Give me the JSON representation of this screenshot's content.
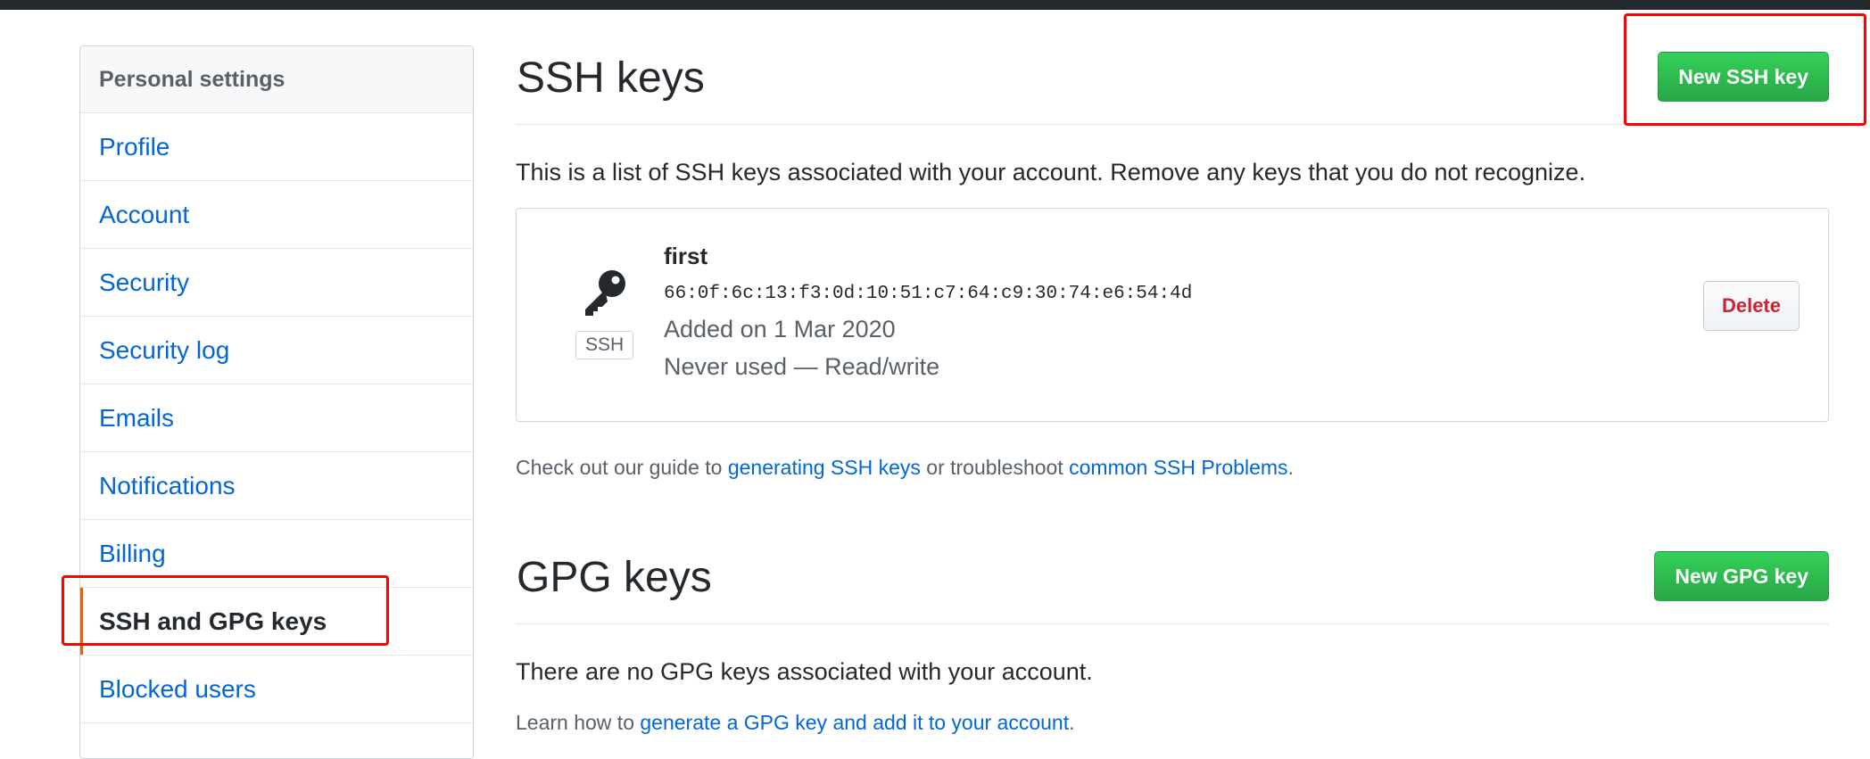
{
  "sidebar": {
    "header": "Personal settings",
    "items": [
      {
        "label": "Profile",
        "name": "sidebar-item-profile",
        "selected": false
      },
      {
        "label": "Account",
        "name": "sidebar-item-account",
        "selected": false
      },
      {
        "label": "Security",
        "name": "sidebar-item-security",
        "selected": false
      },
      {
        "label": "Security log",
        "name": "sidebar-item-security-log",
        "selected": false
      },
      {
        "label": "Emails",
        "name": "sidebar-item-emails",
        "selected": false
      },
      {
        "label": "Notifications",
        "name": "sidebar-item-notifications",
        "selected": false
      },
      {
        "label": "Billing",
        "name": "sidebar-item-billing",
        "selected": false
      },
      {
        "label": "SSH and GPG keys",
        "name": "sidebar-item-ssh-gpg-keys",
        "selected": true
      },
      {
        "label": "Blocked users",
        "name": "sidebar-item-blocked-users",
        "selected": false
      },
      {
        "label": "",
        "name": "sidebar-item-more",
        "selected": false
      }
    ]
  },
  "ssh": {
    "title": "SSH keys",
    "new_button": "New SSH key",
    "intro": "This is a list of SSH keys associated with your account. Remove any keys that you do not recognize.",
    "key": {
      "title": "first",
      "fingerprint": "66:0f:6c:13:f3:0d:10:51:c7:64:c9:30:74:e6:54:4d",
      "added": "Added on 1 Mar 2020",
      "usage": "Never used — Read/write",
      "label": "SSH",
      "delete_button": "Delete",
      "icon": "key-icon"
    },
    "guide": {
      "prefix": "Check out our guide to ",
      "link1": "generating SSH keys",
      "middle": " or troubleshoot ",
      "link2": "common SSH Problems",
      "suffix": "."
    }
  },
  "gpg": {
    "title": "GPG keys",
    "new_button": "New GPG key",
    "intro": "There are no GPG keys associated with your account.",
    "learn": {
      "prefix": "Learn how to ",
      "link": "generate a GPG key and add it to your account",
      "suffix": "."
    }
  },
  "colors": {
    "accent_green": "#28a745",
    "link_blue": "#0366d6",
    "danger_red": "#cb2431",
    "annotation_red": "#ff0000",
    "selected_marker": "#e36209"
  }
}
